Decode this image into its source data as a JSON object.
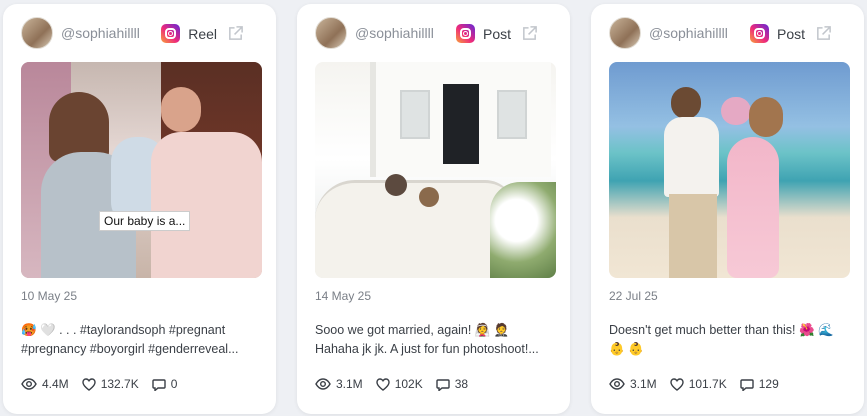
{
  "cards": [
    {
      "handle": "@sophiahillll",
      "type": "Reel",
      "date": "10 May 25",
      "image_overlay": "Our baby is a...",
      "text_line1": "🥵 🤍 . . . #taylorandsoph #pregnant",
      "text_line2": "#pregnancy #boyorgirl #genderreveal...",
      "views": "4.4M",
      "likes": "132.7K",
      "comments": "0"
    },
    {
      "handle": "@sophiahillll",
      "type": "Post",
      "date": "14 May 25",
      "text_line1": "Sooo we got married, again! 👰 🤵",
      "text_line2": "Hahaha jk jk. A just for fun photoshoot!...",
      "views": "3.1M",
      "likes": "102K",
      "comments": "38"
    },
    {
      "handle": "@sophiahillll",
      "type": "Post",
      "date": "22 Jul 25",
      "text_line1": "Doesn't get much better than this! 🌺 🌊",
      "text_line2": "👶 👶",
      "views": "3.1M",
      "likes": "101.7K",
      "comments": "129"
    }
  ],
  "icons": {
    "platform": "instagram-icon",
    "external": "external-link-icon",
    "views": "eye-icon",
    "likes": "heart-icon",
    "comments": "comment-icon"
  },
  "colors": {
    "background": "#eef0f4",
    "card": "#ffffff",
    "muted_text": "#8a8f98",
    "body_text": "#3a3f46"
  }
}
